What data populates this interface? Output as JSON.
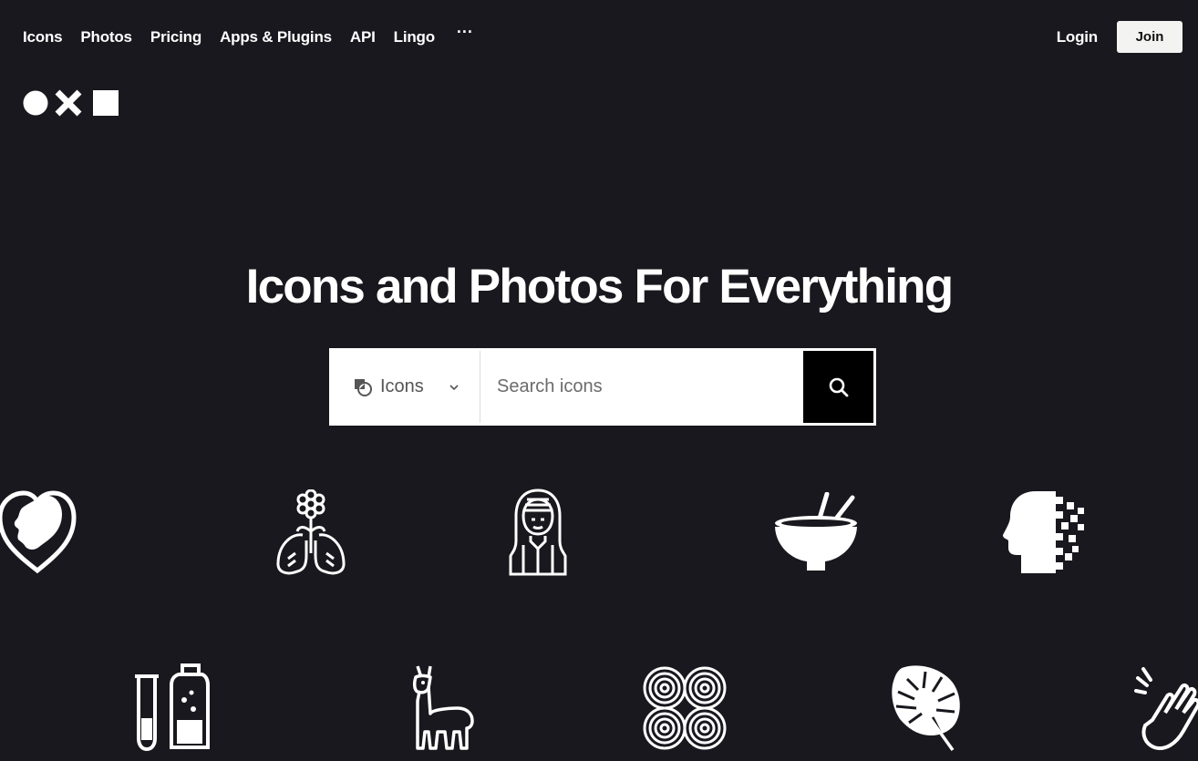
{
  "nav": {
    "links": [
      "Icons",
      "Photos",
      "Pricing",
      "Apps & Plugins",
      "API",
      "Lingo"
    ],
    "more": "···",
    "login": "Login",
    "join": "Join"
  },
  "hero": {
    "title": "Icons and Photos For Everything"
  },
  "search": {
    "type_label": "Icons",
    "placeholder": "Search icons"
  },
  "icons": [
    "heart-face-icon",
    "flower-lungs-icon",
    "woman-portrait-icon",
    "bowl-chopsticks-icon",
    "pixel-head-icon",
    "test-tube-bottle-icon",
    "llama-icon",
    "infinity-spiral-icon",
    "monstera-leaf-icon",
    "clapping-hands-icon"
  ],
  "colors": {
    "background": "#18181e",
    "text": "#ffffff",
    "join_bg": "#f3f3f1",
    "search_button": "#000000"
  }
}
